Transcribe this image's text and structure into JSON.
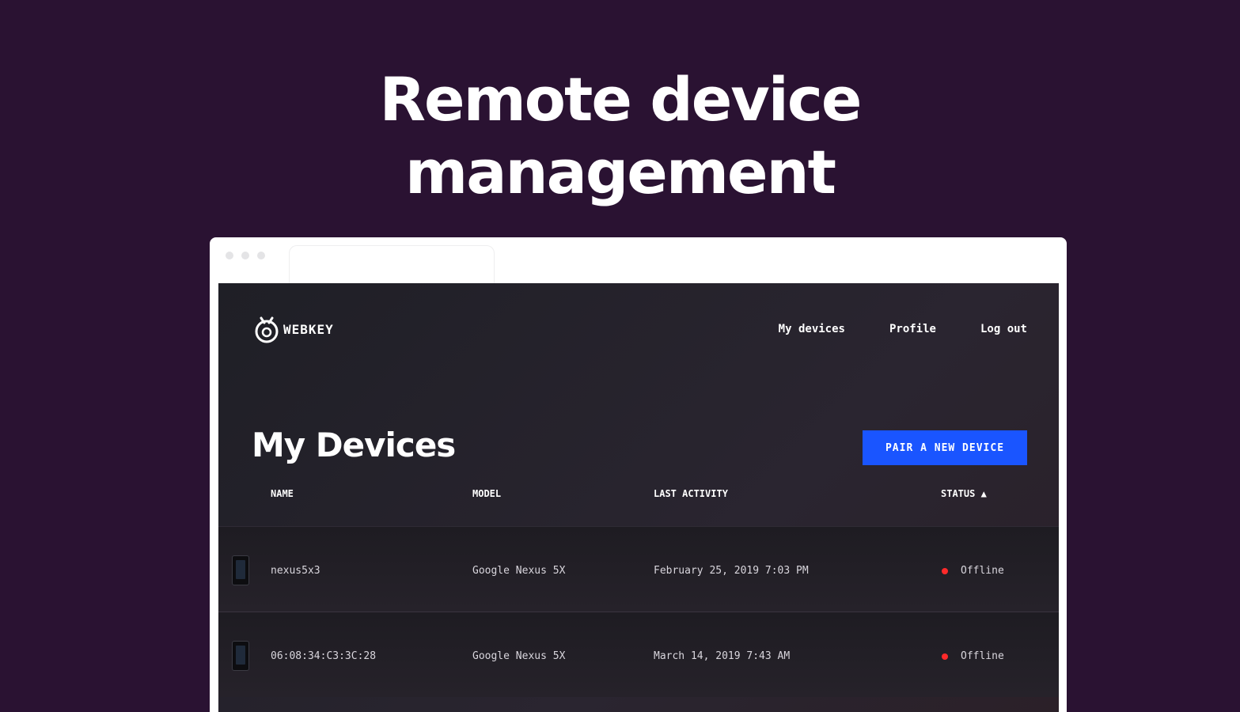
{
  "hero": {
    "line1": "Remote device",
    "line2": "management"
  },
  "app": {
    "logo_text": "WEBKEY",
    "nav": [
      "My devices",
      "Profile",
      "Log out"
    ],
    "page_title": "My Devices",
    "pair_button": "PAIR A NEW DEVICE",
    "columns": [
      "NAME",
      "MODEL",
      "LAST ACTIVITY",
      "STATUS ▲"
    ],
    "devices": [
      {
        "name": "nexus5x3",
        "model": "Google Nexus 5X",
        "last_activity": "February 25, 2019 7:03 PM",
        "status": "Offline"
      },
      {
        "name": "06:08:34:C3:3C:28",
        "model": "Google Nexus 5X",
        "last_activity": "March 14, 2019 7:43 AM",
        "status": "Offline"
      }
    ]
  },
  "colors": {
    "background": "#2a1232",
    "primary_button": "#1a55ff",
    "status_offline": "#ff2a2a"
  }
}
